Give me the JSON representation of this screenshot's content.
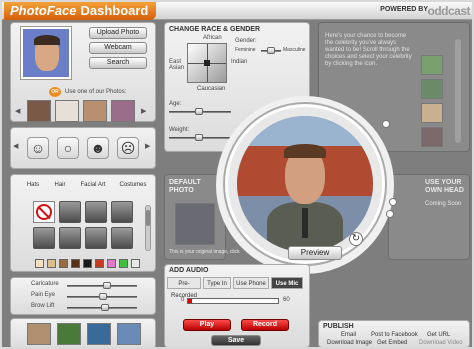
{
  "header": {
    "title_part1": "PhotoFace",
    "title_part2": "Dashboard",
    "powered_by": "POWERED BY",
    "brand": "oddcast"
  },
  "upload": {
    "upload_photo": "Upload Photo",
    "webcam": "Webcam",
    "search": "Search",
    "or": "OR",
    "use_our_photos": "Use one of our Photos:"
  },
  "features": {
    "tabs": [
      "Hats",
      "Hair",
      "Facial Art",
      "Costumes"
    ]
  },
  "sliders": {
    "caricature": "Caricature",
    "pain_eye": "Pain Eye",
    "brow_lift": "Brow Lift"
  },
  "race": {
    "title": "CHANGE RACE & GENDER",
    "african": "African",
    "east_asian": "East\nAsian",
    "caucasian": "Caucasian",
    "indian": "Indian",
    "gender": "Gender:",
    "feminine": "Feminine",
    "masculine": "Masculine",
    "age": "Age:",
    "weight": "Weight:"
  },
  "celebrity": {
    "text": "Here's your chance to become the celebrity you've always wanted to be! Scroll through the choices and select your celebrity by clicking the icon."
  },
  "default_photo": {
    "title": "DEFAULT PHOTO",
    "caption": "This is your original image, click"
  },
  "own_head": {
    "title": "USE YOUR OWN HEAD",
    "coming_soon": "Coming Soon"
  },
  "preview": {
    "label": "Preview"
  },
  "audio": {
    "title": "ADD AUDIO",
    "tabs": [
      "Pre-Recorded",
      "Type In",
      "Use Phone",
      "Use Mic"
    ],
    "level_start": "0",
    "level_end": "60",
    "play": "Play",
    "record": "Record",
    "save": "Save"
  },
  "publish": {
    "title": "PUBLISH",
    "links": [
      "Email",
      "Post to Facebook",
      "Get URL",
      "Download Image",
      "Get Embed",
      "Download Video"
    ]
  },
  "colors": {
    "accent": "#e07a1a",
    "record_red": "#c01010"
  }
}
